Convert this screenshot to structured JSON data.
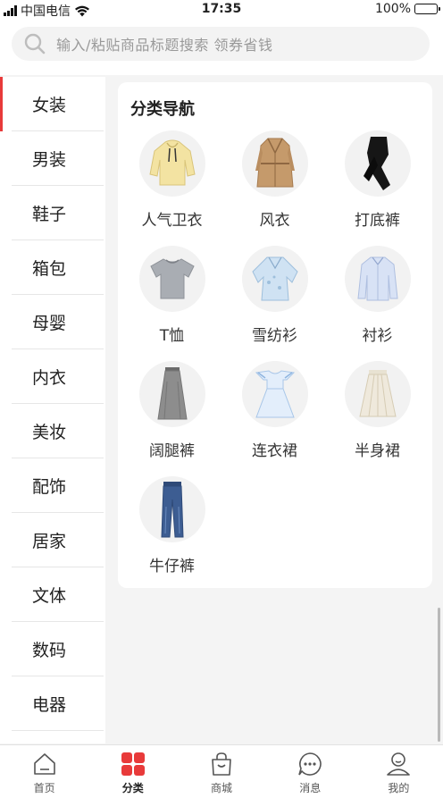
{
  "status_bar": {
    "carrier": "中国电信",
    "time": "17:35",
    "battery": "100%"
  },
  "search": {
    "placeholder": "输入/粘贴商品标题搜索 领券省钱"
  },
  "sidebar": {
    "items": [
      {
        "label": "女装",
        "active": true
      },
      {
        "label": "男装"
      },
      {
        "label": "鞋子"
      },
      {
        "label": "箱包"
      },
      {
        "label": "母婴"
      },
      {
        "label": "内衣"
      },
      {
        "label": "美妆"
      },
      {
        "label": "配饰"
      },
      {
        "label": "居家"
      },
      {
        "label": "文体"
      },
      {
        "label": "数码"
      },
      {
        "label": "电器"
      }
    ]
  },
  "content": {
    "title": "分类导航",
    "categories": [
      {
        "label": "人气卫衣",
        "icon": "hoodie-icon"
      },
      {
        "label": "风衣",
        "icon": "trench-coat-icon"
      },
      {
        "label": "打底裤",
        "icon": "leggings-icon"
      },
      {
        "label": "T恤",
        "icon": "tshirt-icon"
      },
      {
        "label": "雪纺衫",
        "icon": "chiffon-blouse-icon"
      },
      {
        "label": "衬衫",
        "icon": "shirt-icon"
      },
      {
        "label": "阔腿裤",
        "icon": "wide-leg-pants-icon"
      },
      {
        "label": "连衣裙",
        "icon": "dress-icon"
      },
      {
        "label": "半身裙",
        "icon": "skirt-icon"
      },
      {
        "label": "牛仔裤",
        "icon": "jeans-icon"
      }
    ]
  },
  "tabbar": {
    "items": [
      {
        "label": "首页",
        "icon": "home-icon"
      },
      {
        "label": "分类",
        "icon": "category-icon",
        "active": true
      },
      {
        "label": "商城",
        "icon": "shopping-bag-icon"
      },
      {
        "label": "消息",
        "icon": "message-icon"
      },
      {
        "label": "我的",
        "icon": "profile-icon"
      }
    ]
  },
  "colors": {
    "accent": "#e83a3a",
    "background": "#f4f4f4"
  }
}
